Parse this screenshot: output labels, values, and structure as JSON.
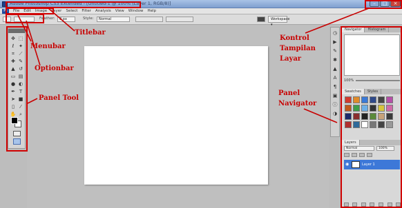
{
  "window": {
    "title": "Adobe Photoshop CS3 Extended - [Untitled-1 @ 100% (Layer 1, RGB/8)]",
    "controls": {
      "minimize": "–",
      "maximize": "□",
      "close": "×"
    }
  },
  "menubar": {
    "logo": "Ps",
    "items": [
      "File",
      "Edit",
      "Image",
      "Layer",
      "Select",
      "Filter",
      "Analysis",
      "View",
      "Window",
      "Help"
    ]
  },
  "optionsbar": {
    "feather_label": "Feather:",
    "feather_value": "0 px",
    "style_label": "Style:",
    "style_value": "Normal",
    "workspace": "Workspace ▾"
  },
  "tools": {
    "icons": [
      "move-icon",
      "marquee-icon",
      "lasso-icon",
      "magic-wand-icon",
      "crop-icon",
      "slice-icon",
      "healing-icon",
      "brush-icon",
      "stamp-icon",
      "history-brush-icon",
      "eraser-icon",
      "gradient-icon",
      "blur-icon",
      "dodge-icon",
      "pen-icon",
      "type-icon",
      "path-select-icon",
      "shape-icon",
      "notes-icon",
      "eyedropper-icon",
      "hand-icon",
      "zoom-icon"
    ]
  },
  "panels": {
    "navigator_tab": "Navigator",
    "histogram_tab": "Histogram",
    "zoom": "100%",
    "swatches_tab": "Swatches",
    "styles_tab": "Styles",
    "layers_tab": "Layers",
    "blend_mode": "Normal",
    "opacity": "100%",
    "layer_name": "Layer 1"
  },
  "colors": {
    "annotation": "#c80000",
    "layer_selected": "#3d78d8",
    "swatches": [
      "#d23b2e",
      "#e08b2a",
      "#3a7ad8",
      "#2f4a8a",
      "#444444",
      "#b64fa8",
      "#c25a1e",
      "#3f9e4a",
      "#6fb0e8",
      "#333333",
      "#d8c43c",
      "#d06aa8",
      "#1c2a6a",
      "#8a2e2e",
      "#222222",
      "#5a8a3a",
      "#c7a27a",
      "#3a3a3a",
      "#b03030",
      "#2e6a9a",
      "#ffffff",
      "#777777",
      "#444444",
      "#999999"
    ]
  },
  "annotations": {
    "titlebar": "Titlebar",
    "menubar": "Menubar",
    "optionbar": "Optionbar",
    "panel_tool": "Panel Tool",
    "kontrol": [
      "Kontrol",
      "Tampilan",
      "Layar"
    ],
    "panel_navigator": [
      "Panel",
      "Navigator"
    ]
  }
}
